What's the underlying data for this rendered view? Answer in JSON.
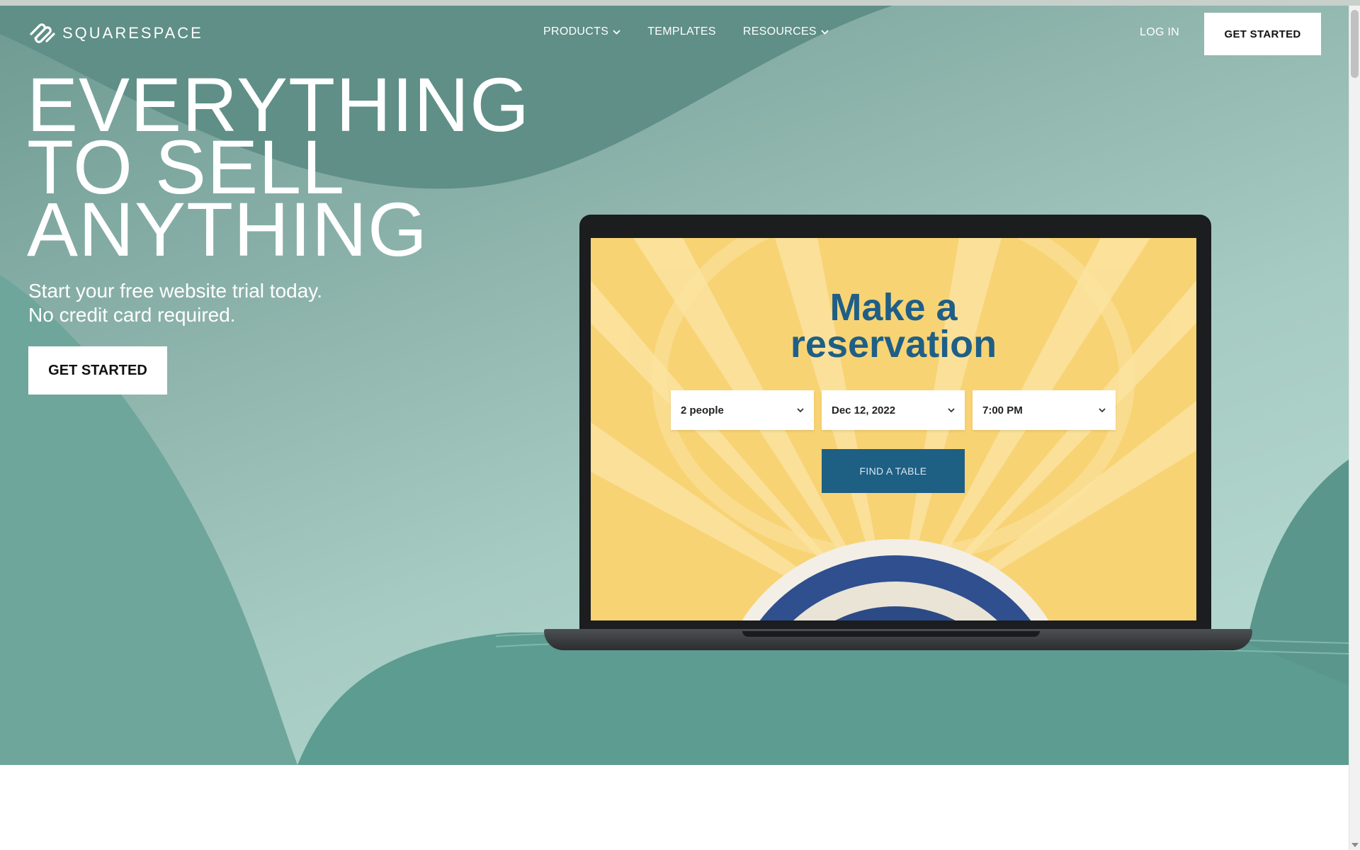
{
  "nav": {
    "logo_text": "SQUARESPACE",
    "items": [
      {
        "label": "PRODUCTS",
        "has_dropdown": true
      },
      {
        "label": "TEMPLATES",
        "has_dropdown": false
      },
      {
        "label": "RESOURCES",
        "has_dropdown": true
      }
    ],
    "login_label": "LOG IN",
    "cta_label": "GET STARTED"
  },
  "hero": {
    "headline_lines": [
      "EVERYTHING",
      "TO SELL",
      "ANYTHING"
    ],
    "subline_lines": [
      "Start your free website trial today.",
      "No credit card required."
    ],
    "cta_label": "GET STARTED"
  },
  "laptop_screen": {
    "title_lines": [
      "Make a",
      "reservation"
    ],
    "party_size": "2 people",
    "date": "Dec 12, 2022",
    "time": "7:00 PM",
    "find_button_label": "FIND A TABLE"
  },
  "colors": {
    "hero_teal": "#8fb5ad",
    "reservation_blue": "#1f5f86",
    "screen_yellow": "#f8d374"
  }
}
